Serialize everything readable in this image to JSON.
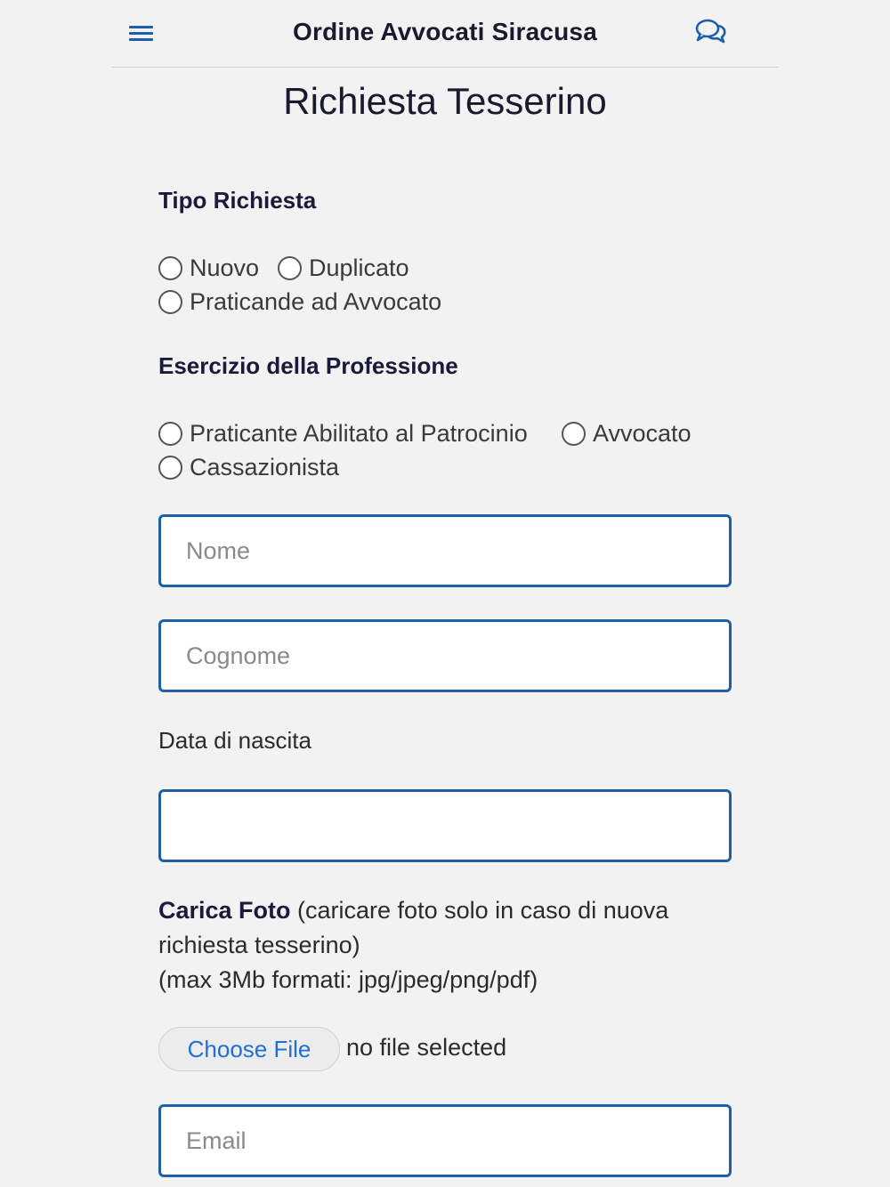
{
  "header": {
    "menu_icon": "hamburger-menu-icon",
    "title": "Ordine Avvocati Siracusa",
    "chat_icon": "chat-bubbles-icon",
    "accent_color": "#1f5fa8"
  },
  "page_title": "Richiesta Tesserino",
  "tipo_richiesta": {
    "label": "Tipo Richiesta",
    "options": [
      "Nuovo",
      "Duplicato",
      "Praticande ad Avvocato"
    ]
  },
  "esercizio": {
    "label": "Esercizio della Professione",
    "options": [
      "Praticante Abilitato al Patrocinio",
      "Avvocato",
      "Cassazionista"
    ]
  },
  "fields": {
    "nome_placeholder": "Nome",
    "cognome_placeholder": "Cognome",
    "data_nascita_label": "Data di nascita",
    "data_nascita_value": "",
    "email_placeholder": "Email"
  },
  "upload": {
    "label_bold": "Carica Foto",
    "label_rest": " (caricare foto solo in caso di nuova richiesta tesserino)",
    "note": "(max 3Mb formati: jpg/jpeg/png/pdf)",
    "button_label": "Choose File",
    "status": "no file selected"
  }
}
